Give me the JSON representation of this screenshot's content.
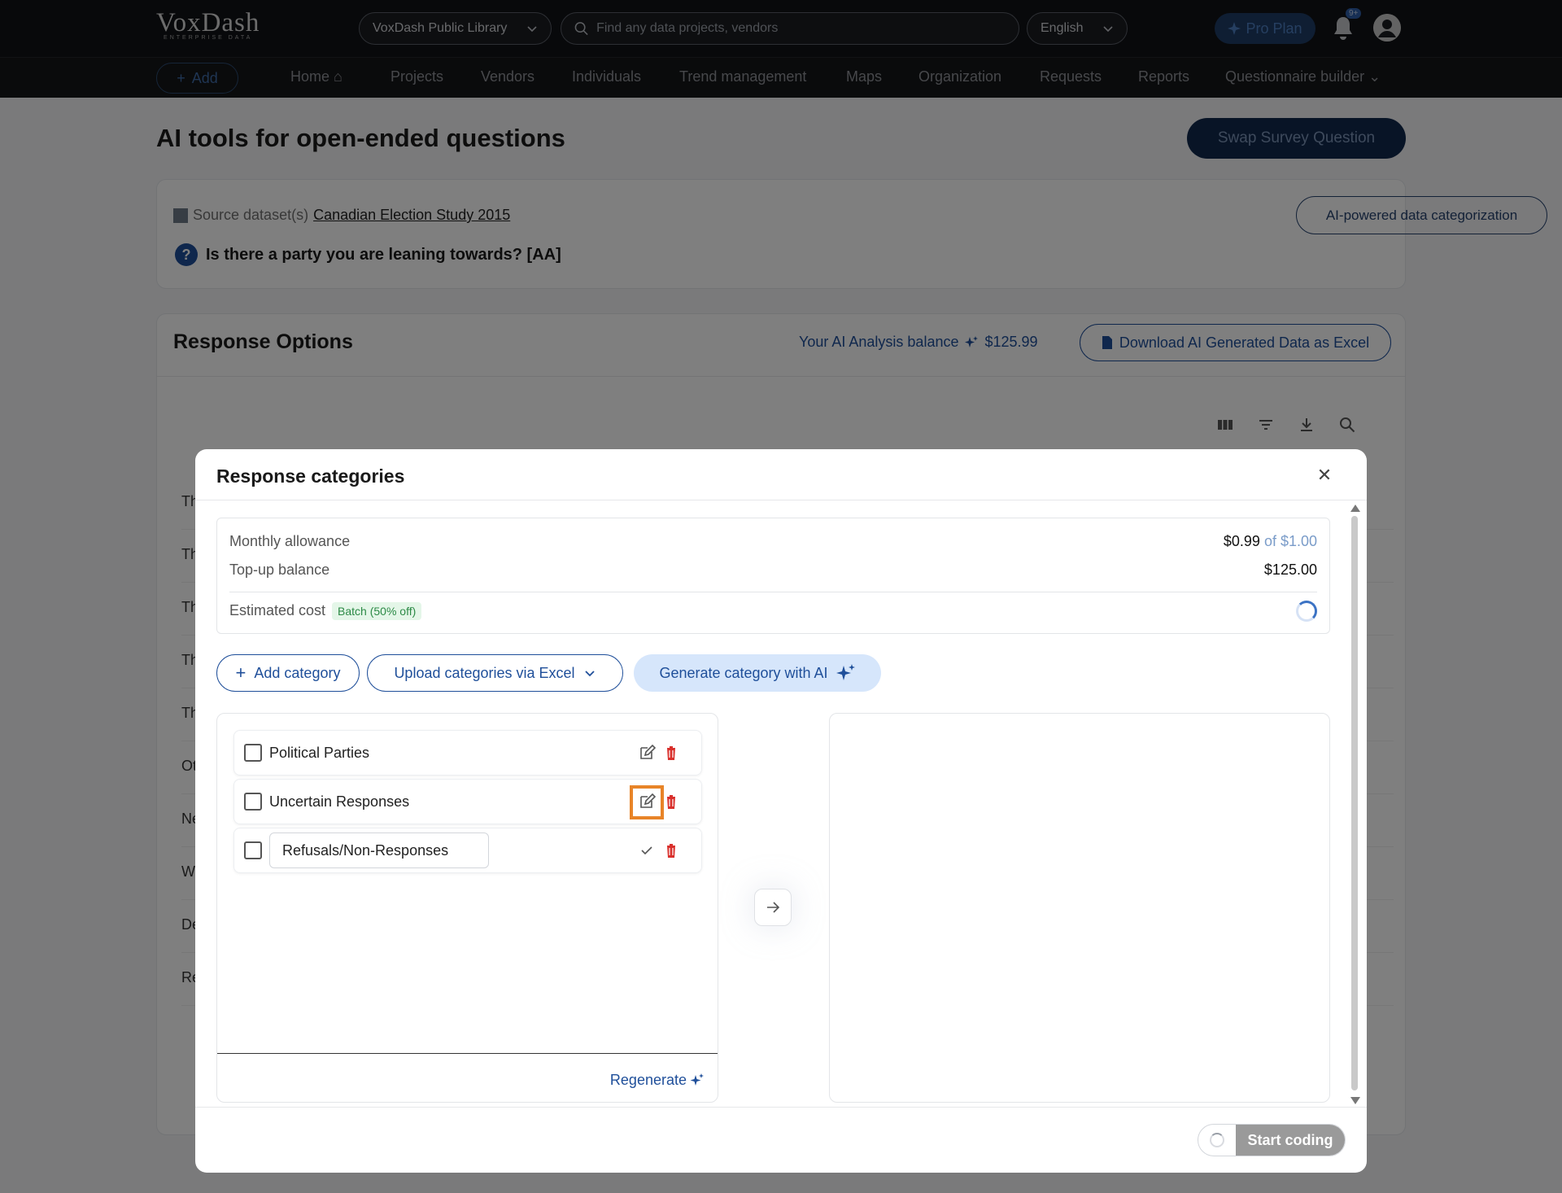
{
  "header": {
    "logo": "VoxDash",
    "logo_tagline": "ENTERPRISE DATA",
    "library_select": "VoxDash Public Library",
    "search_placeholder": "Find any data projects, vendors",
    "language": "English",
    "pro_plan": "Pro Plan",
    "notifications_badge": "9+"
  },
  "nav": {
    "add_label": "Add",
    "items": [
      "Home",
      "Projects",
      "Vendors",
      "Individuals",
      "Trend management",
      "Maps",
      "Organization",
      "Requests",
      "Reports",
      "Questionnaire builder"
    ]
  },
  "page": {
    "title": "AI tools for open-ended questions",
    "swap_button": "Swap Survey Question",
    "source_prefix": "Source dataset(s)",
    "source_link": "Canadian Election Study 2015",
    "question": "Is there a party you are leaning towards? [AA]",
    "ai_categorization_button": "AI-powered data categorization"
  },
  "response_options": {
    "title": "Response Options",
    "balance_label": "Your AI Analysis balance",
    "balance_value": "$125.99",
    "download_button": "Download AI Generated Data as Excel",
    "row_prefixes": [
      "Th",
      "Th",
      "Th",
      "Th",
      "Th",
      "Ot",
      "Ne",
      "W",
      "De",
      "Re"
    ]
  },
  "modal": {
    "title": "Response categories",
    "monthly_allowance_label": "Monthly allowance",
    "monthly_allowance_value": "$0.99",
    "monthly_allowance_total": "of $1.00",
    "topup_label": "Top-up balance",
    "topup_value": "$125.00",
    "estimated_cost_label": "Estimated cost",
    "batch_badge": "Batch (50% off)",
    "add_category": "Add category",
    "upload_categories": "Upload categories via Excel",
    "generate_ai": "Generate category with AI",
    "categories": [
      {
        "label": "Political Parties",
        "editing": false
      },
      {
        "label": "Uncertain Responses",
        "editing": false
      },
      {
        "label": "Refusals/Non-Responses",
        "editing": true
      }
    ],
    "regenerate": "Regenerate",
    "start_coding": "Start coding"
  },
  "colors": {
    "accent": "#1f4f9a",
    "focus_outline": "#e88428",
    "delete": "#d9302c",
    "badge_green": "#2c8a46"
  }
}
